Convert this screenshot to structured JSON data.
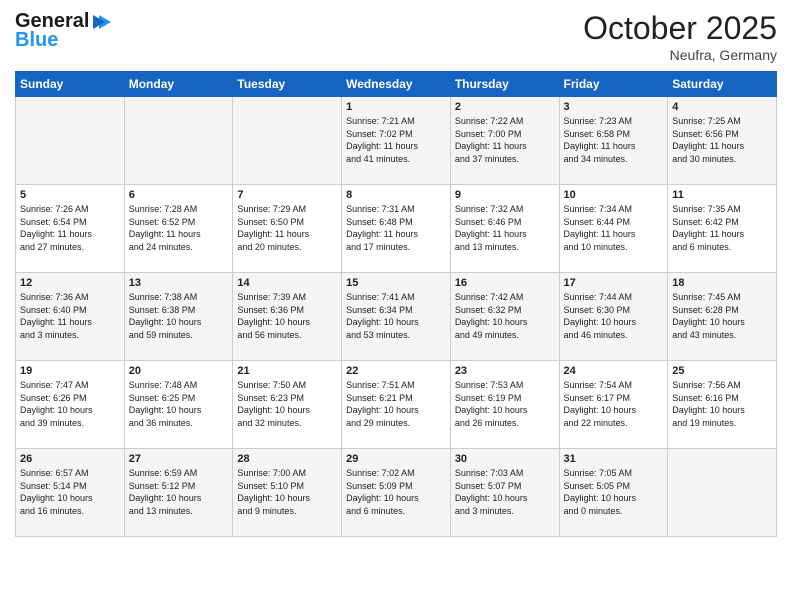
{
  "logo": {
    "line1": "General",
    "line2": "Blue"
  },
  "title": "October 2025",
  "location": "Neufra, Germany",
  "days_of_week": [
    "Sunday",
    "Monday",
    "Tuesday",
    "Wednesday",
    "Thursday",
    "Friday",
    "Saturday"
  ],
  "weeks": [
    [
      {
        "day": "",
        "content": ""
      },
      {
        "day": "",
        "content": ""
      },
      {
        "day": "",
        "content": ""
      },
      {
        "day": "1",
        "content": "Sunrise: 7:21 AM\nSunset: 7:02 PM\nDaylight: 11 hours\nand 41 minutes."
      },
      {
        "day": "2",
        "content": "Sunrise: 7:22 AM\nSunset: 7:00 PM\nDaylight: 11 hours\nand 37 minutes."
      },
      {
        "day": "3",
        "content": "Sunrise: 7:23 AM\nSunset: 6:58 PM\nDaylight: 11 hours\nand 34 minutes."
      },
      {
        "day": "4",
        "content": "Sunrise: 7:25 AM\nSunset: 6:56 PM\nDaylight: 11 hours\nand 30 minutes."
      }
    ],
    [
      {
        "day": "5",
        "content": "Sunrise: 7:26 AM\nSunset: 6:54 PM\nDaylight: 11 hours\nand 27 minutes."
      },
      {
        "day": "6",
        "content": "Sunrise: 7:28 AM\nSunset: 6:52 PM\nDaylight: 11 hours\nand 24 minutes."
      },
      {
        "day": "7",
        "content": "Sunrise: 7:29 AM\nSunset: 6:50 PM\nDaylight: 11 hours\nand 20 minutes."
      },
      {
        "day": "8",
        "content": "Sunrise: 7:31 AM\nSunset: 6:48 PM\nDaylight: 11 hours\nand 17 minutes."
      },
      {
        "day": "9",
        "content": "Sunrise: 7:32 AM\nSunset: 6:46 PM\nDaylight: 11 hours\nand 13 minutes."
      },
      {
        "day": "10",
        "content": "Sunrise: 7:34 AM\nSunset: 6:44 PM\nDaylight: 11 hours\nand 10 minutes."
      },
      {
        "day": "11",
        "content": "Sunrise: 7:35 AM\nSunset: 6:42 PM\nDaylight: 11 hours\nand 6 minutes."
      }
    ],
    [
      {
        "day": "12",
        "content": "Sunrise: 7:36 AM\nSunset: 6:40 PM\nDaylight: 11 hours\nand 3 minutes."
      },
      {
        "day": "13",
        "content": "Sunrise: 7:38 AM\nSunset: 6:38 PM\nDaylight: 10 hours\nand 59 minutes."
      },
      {
        "day": "14",
        "content": "Sunrise: 7:39 AM\nSunset: 6:36 PM\nDaylight: 10 hours\nand 56 minutes."
      },
      {
        "day": "15",
        "content": "Sunrise: 7:41 AM\nSunset: 6:34 PM\nDaylight: 10 hours\nand 53 minutes."
      },
      {
        "day": "16",
        "content": "Sunrise: 7:42 AM\nSunset: 6:32 PM\nDaylight: 10 hours\nand 49 minutes."
      },
      {
        "day": "17",
        "content": "Sunrise: 7:44 AM\nSunset: 6:30 PM\nDaylight: 10 hours\nand 46 minutes."
      },
      {
        "day": "18",
        "content": "Sunrise: 7:45 AM\nSunset: 6:28 PM\nDaylight: 10 hours\nand 43 minutes."
      }
    ],
    [
      {
        "day": "19",
        "content": "Sunrise: 7:47 AM\nSunset: 6:26 PM\nDaylight: 10 hours\nand 39 minutes."
      },
      {
        "day": "20",
        "content": "Sunrise: 7:48 AM\nSunset: 6:25 PM\nDaylight: 10 hours\nand 36 minutes."
      },
      {
        "day": "21",
        "content": "Sunrise: 7:50 AM\nSunset: 6:23 PM\nDaylight: 10 hours\nand 32 minutes."
      },
      {
        "day": "22",
        "content": "Sunrise: 7:51 AM\nSunset: 6:21 PM\nDaylight: 10 hours\nand 29 minutes."
      },
      {
        "day": "23",
        "content": "Sunrise: 7:53 AM\nSunset: 6:19 PM\nDaylight: 10 hours\nand 26 minutes."
      },
      {
        "day": "24",
        "content": "Sunrise: 7:54 AM\nSunset: 6:17 PM\nDaylight: 10 hours\nand 22 minutes."
      },
      {
        "day": "25",
        "content": "Sunrise: 7:56 AM\nSunset: 6:16 PM\nDaylight: 10 hours\nand 19 minutes."
      }
    ],
    [
      {
        "day": "26",
        "content": "Sunrise: 6:57 AM\nSunset: 5:14 PM\nDaylight: 10 hours\nand 16 minutes."
      },
      {
        "day": "27",
        "content": "Sunrise: 6:59 AM\nSunset: 5:12 PM\nDaylight: 10 hours\nand 13 minutes."
      },
      {
        "day": "28",
        "content": "Sunrise: 7:00 AM\nSunset: 5:10 PM\nDaylight: 10 hours\nand 9 minutes."
      },
      {
        "day": "29",
        "content": "Sunrise: 7:02 AM\nSunset: 5:09 PM\nDaylight: 10 hours\nand 6 minutes."
      },
      {
        "day": "30",
        "content": "Sunrise: 7:03 AM\nSunset: 5:07 PM\nDaylight: 10 hours\nand 3 minutes."
      },
      {
        "day": "31",
        "content": "Sunrise: 7:05 AM\nSunset: 5:05 PM\nDaylight: 10 hours\nand 0 minutes."
      },
      {
        "day": "",
        "content": ""
      }
    ]
  ]
}
